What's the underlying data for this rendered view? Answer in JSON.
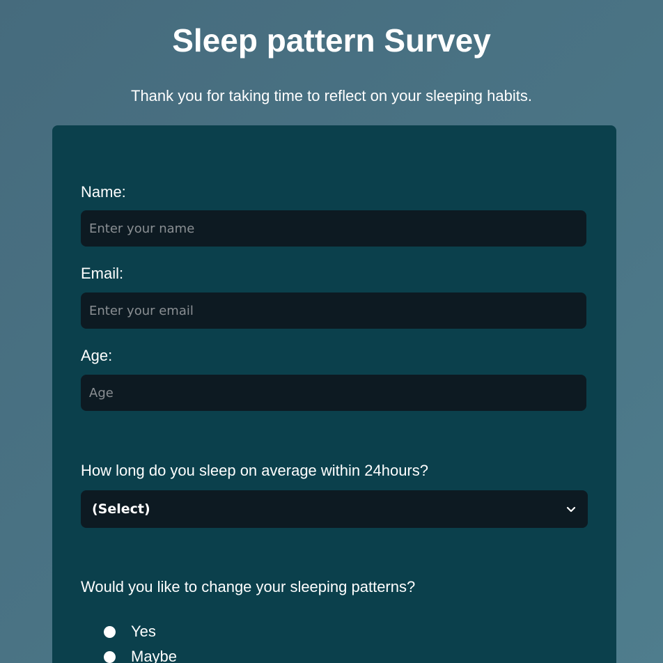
{
  "header": {
    "title": "Sleep pattern Survey",
    "subtitle": "Thank you for taking time to reflect on your sleeping habits."
  },
  "form": {
    "name": {
      "label": "Name:",
      "placeholder": "Enter your name",
      "value": ""
    },
    "email": {
      "label": "Email:",
      "placeholder": "Enter your email",
      "value": ""
    },
    "age": {
      "label": "Age:",
      "placeholder": "Age",
      "value": ""
    },
    "sleep_duration": {
      "label": "How long do you sleep on average within 24hours?",
      "selected": "(Select)"
    },
    "change_patterns": {
      "label": "Would you like to change your sleeping patterns?",
      "options": [
        {
          "label": "Yes"
        },
        {
          "label": "Maybe"
        }
      ]
    }
  },
  "colors": {
    "background": "#4a7385",
    "card": "#0b404c",
    "input": "#0d1a22",
    "text": "#ffffff",
    "placeholder": "#8a8f93"
  },
  "icons": {
    "select_indicator": "chevron-down-icon"
  }
}
